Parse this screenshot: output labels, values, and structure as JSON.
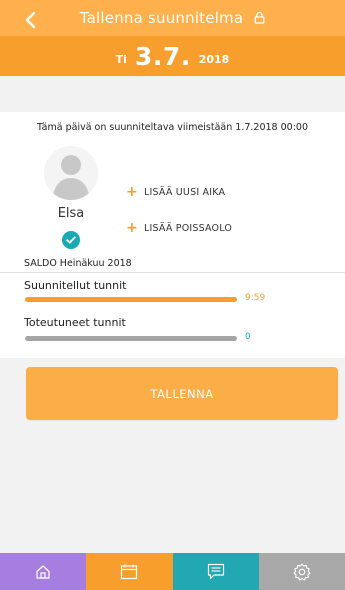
{
  "header": {
    "title": "Tallenna suunnitelma",
    "back_icon": "chevron-left-icon",
    "lock_icon": "lock-icon"
  },
  "date": {
    "weekday": "Ti",
    "day": "3.7.",
    "year": "2018"
  },
  "deadline_text": "Tämä päivä on suunniteltava viimeistään 1.7.2018 00:00",
  "user": {
    "name": "Elsa",
    "avatar_icon": "avatar-placeholder-icon",
    "status_icon": "check-circle-icon"
  },
  "actions": [
    {
      "label": "LISÄÄ UUSI AIKA",
      "icon": "plus-icon"
    },
    {
      "label": "LISÄÄ POISSAOLO",
      "icon": "plus-icon"
    }
  ],
  "saldo": {
    "title": "SALDO  Heinäkuu 2018",
    "planned": {
      "label": "Suunnitellut tunnit",
      "value": "9:59",
      "progress_percent": 100
    },
    "actual": {
      "label": "Toteutuneet tunnit",
      "value": "0",
      "progress_percent": 0
    }
  },
  "save_button": {
    "label": "TALLENNA"
  },
  "nav": [
    {
      "icon": "home-icon",
      "bg": "#a67ee0"
    },
    {
      "icon": "calendar-icon",
      "bg": "#f89e2d"
    },
    {
      "icon": "message-icon",
      "bg": "#21a8b3"
    },
    {
      "icon": "settings-icon",
      "bg": "#a8a8a8"
    }
  ],
  "colors": {
    "accent": "#f89e2d",
    "header": "#fdab45",
    "teal": "#21a8b3",
    "planned_value": "#f89e2d",
    "actual_value": "#1aa8b2"
  }
}
